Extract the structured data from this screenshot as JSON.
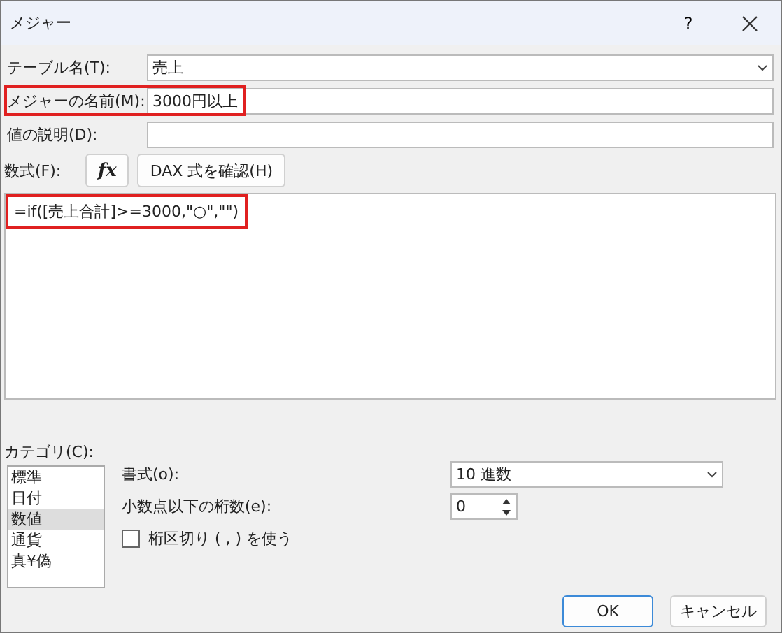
{
  "window": {
    "title": "メジャー",
    "help": "?"
  },
  "fields": [
    {
      "kind": "dropdown",
      "label": "テーブル名(T):",
      "value": "売上",
      "highlighted": false
    },
    {
      "kind": "text",
      "label": "メジャーの名前(M):",
      "value": "3000円以上",
      "highlighted": true
    },
    {
      "kind": "text",
      "label": "値の説明(D):",
      "highlighted": false
    }
  ],
  "formula": {
    "label": "数式(F):",
    "fx_button": "fx",
    "dax_button": "DAX 式を確認(H)",
    "text": "=if([売上合計]>=3000,\"○\",\"\")",
    "highlighted": true
  },
  "category": {
    "label": "カテゴリ(C):",
    "items": [
      {
        "label": "標準",
        "selected": false
      },
      {
        "label": "日付",
        "selected": false
      },
      {
        "label": "数値",
        "selected": true
      },
      {
        "label": "通貨",
        "selected": false
      },
      {
        "label": "真¥偽",
        "selected": false
      }
    ]
  },
  "format": {
    "label": "書式(o):",
    "value": "10 進数"
  },
  "decimals": {
    "label": "小数点以下の桁数(e):",
    "value": "0"
  },
  "separator": {
    "label": "桁区切り ( , ) を使う",
    "checked": false
  },
  "buttons": [
    {
      "label": "OK",
      "default": true
    },
    {
      "label": "キャンセル",
      "default": false
    }
  ]
}
